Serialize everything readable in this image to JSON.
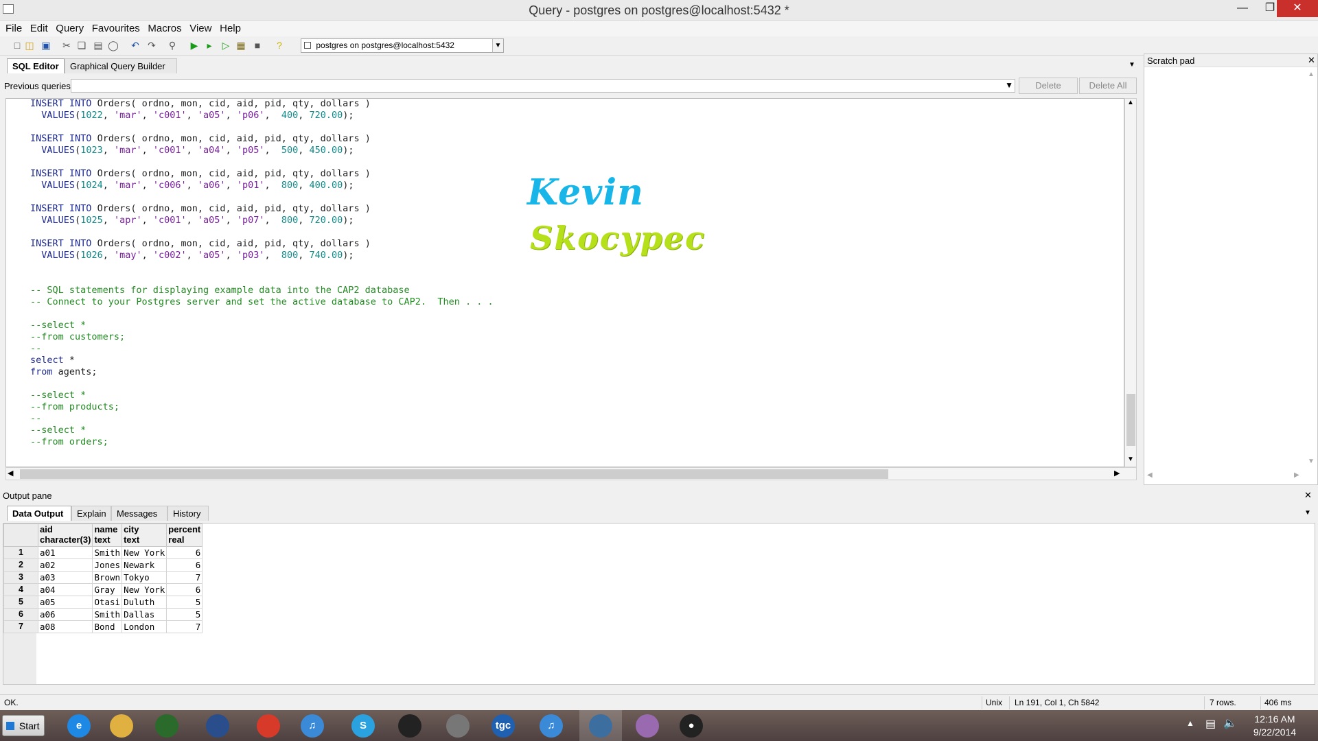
{
  "window": {
    "title": "Query - postgres on postgres@localhost:5432 *"
  },
  "menu": [
    "File",
    "Edit",
    "Query",
    "Favourites",
    "Macros",
    "View",
    "Help"
  ],
  "toolbar": {
    "connection": "postgres on postgres@localhost:5432"
  },
  "editor": {
    "tabs": [
      "SQL Editor",
      "Graphical Query Builder"
    ],
    "previous_queries_label": "Previous queries",
    "delete_label": "Delete",
    "delete_all_label": "Delete All"
  },
  "code_lines": [
    "INSERT INTO Orders( ordno, mon, cid, aid, pid, qty, dollars )",
    "  VALUES(1022, 'mar', 'c001', 'a05', 'p06',  400, 720.00);",
    "",
    "INSERT INTO Orders( ordno, mon, cid, aid, pid, qty, dollars )",
    "  VALUES(1023, 'mar', 'c001', 'a04', 'p05',  500, 450.00);",
    "",
    "INSERT INTO Orders( ordno, mon, cid, aid, pid, qty, dollars )",
    "  VALUES(1024, 'mar', 'c006', 'a06', 'p01',  800, 400.00);",
    "",
    "INSERT INTO Orders( ordno, mon, cid, aid, pid, qty, dollars )",
    "  VALUES(1025, 'apr', 'c001', 'a05', 'p07',  800, 720.00);",
    "",
    "INSERT INTO Orders( ordno, mon, cid, aid, pid, qty, dollars )",
    "  VALUES(1026, 'may', 'c002', 'a05', 'p03',  800, 740.00);",
    "",
    "",
    "-- SQL statements for displaying example data into the CAP2 database",
    "-- Connect to your Postgres server and set the active database to CAP2.  Then . . .",
    "",
    "--select *",
    "--from customers;",
    "--",
    "select *",
    "from agents;",
    "",
    "--select *",
    "--from products;",
    "--",
    "--select *",
    "--from orders;"
  ],
  "watermark": {
    "line1": "Kevin",
    "line2": "Skocypec"
  },
  "scratch": {
    "title": "Scratch pad"
  },
  "output": {
    "title": "Output pane",
    "tabs": [
      "Data Output",
      "Explain",
      "Messages",
      "History"
    ],
    "columns": [
      {
        "name": "aid",
        "type": "character(3)"
      },
      {
        "name": "name",
        "type": "text"
      },
      {
        "name": "city",
        "type": "text"
      },
      {
        "name": "percent",
        "type": "real"
      }
    ],
    "rows": [
      [
        "1",
        "a01",
        "Smith",
        "New York",
        "6"
      ],
      [
        "2",
        "a02",
        "Jones",
        "Newark",
        "6"
      ],
      [
        "3",
        "a03",
        "Brown",
        "Tokyo",
        "7"
      ],
      [
        "4",
        "a04",
        "Gray",
        "New York",
        "6"
      ],
      [
        "5",
        "a05",
        "Otasi",
        "Duluth",
        "5"
      ],
      [
        "6",
        "a06",
        "Smith",
        "Dallas",
        "5"
      ],
      [
        "7",
        "a08",
        "Bond",
        "London",
        "7"
      ]
    ]
  },
  "status": {
    "msg": "OK.",
    "eol": "Unix",
    "pos": "Ln 191, Col 1, Ch 5842",
    "rows": "7 rows.",
    "time": "406 ms"
  },
  "taskbar": {
    "start": "Start",
    "time": "12:16 AM",
    "date": "9/22/2014",
    "apps": [
      "internet-explorer",
      "file-explorer",
      "razer",
      "lenovo",
      "chrome",
      "itunes",
      "skype",
      "steam",
      "files",
      "tgc",
      "itunes-2",
      "pgadmin",
      "paint",
      "github"
    ]
  }
}
